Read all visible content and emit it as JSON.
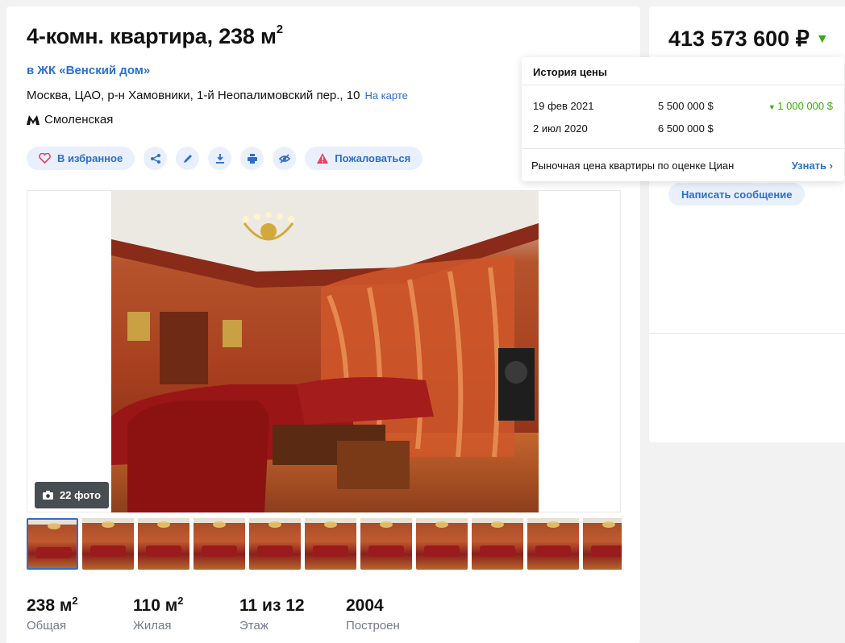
{
  "listing": {
    "title": "4-комн. квартира, 238 м",
    "title_sup": "2",
    "complex": "в ЖК «Венский дом»",
    "address": "Москва, ЦАО, р-н Хамовники, 1-й Неопалимовский пер., 10",
    "map_link": "На карте",
    "metro": "Смоленская"
  },
  "actions": {
    "favorite": "В избранное",
    "report": "Пожаловаться",
    "icons": [
      "share-icon",
      "edit-icon",
      "download-icon",
      "print-icon",
      "hide-icon"
    ]
  },
  "gallery": {
    "photo_count": "22 фото",
    "thumbnail_count": 11
  },
  "stats": [
    {
      "value": "238 м",
      "sup": "2",
      "label": "Общая"
    },
    {
      "value": "110 м",
      "sup": "2",
      "label": "Жилая"
    },
    {
      "value": "11 из 12",
      "sup": "",
      "label": "Этаж"
    },
    {
      "value": "2004",
      "sup": "",
      "label": "Построен"
    }
  ],
  "price": {
    "value": "413 573 600 ₽",
    "trend": "down"
  },
  "price_history": {
    "title": "История цены",
    "rows": [
      {
        "date": "19 фев 2021",
        "price": "5 500 000 $",
        "change": "1 000 000 $"
      },
      {
        "date": "2 июл 2020",
        "price": "6 500 000 $",
        "change": ""
      }
    ],
    "market_note": "Рыночная цена квартиры по оценке Циан",
    "learn_more": "Узнать"
  },
  "contact": {
    "message_button": "Написать сообщение"
  },
  "colors": {
    "accent": "#2b6ecf",
    "green": "#34ac0a"
  }
}
